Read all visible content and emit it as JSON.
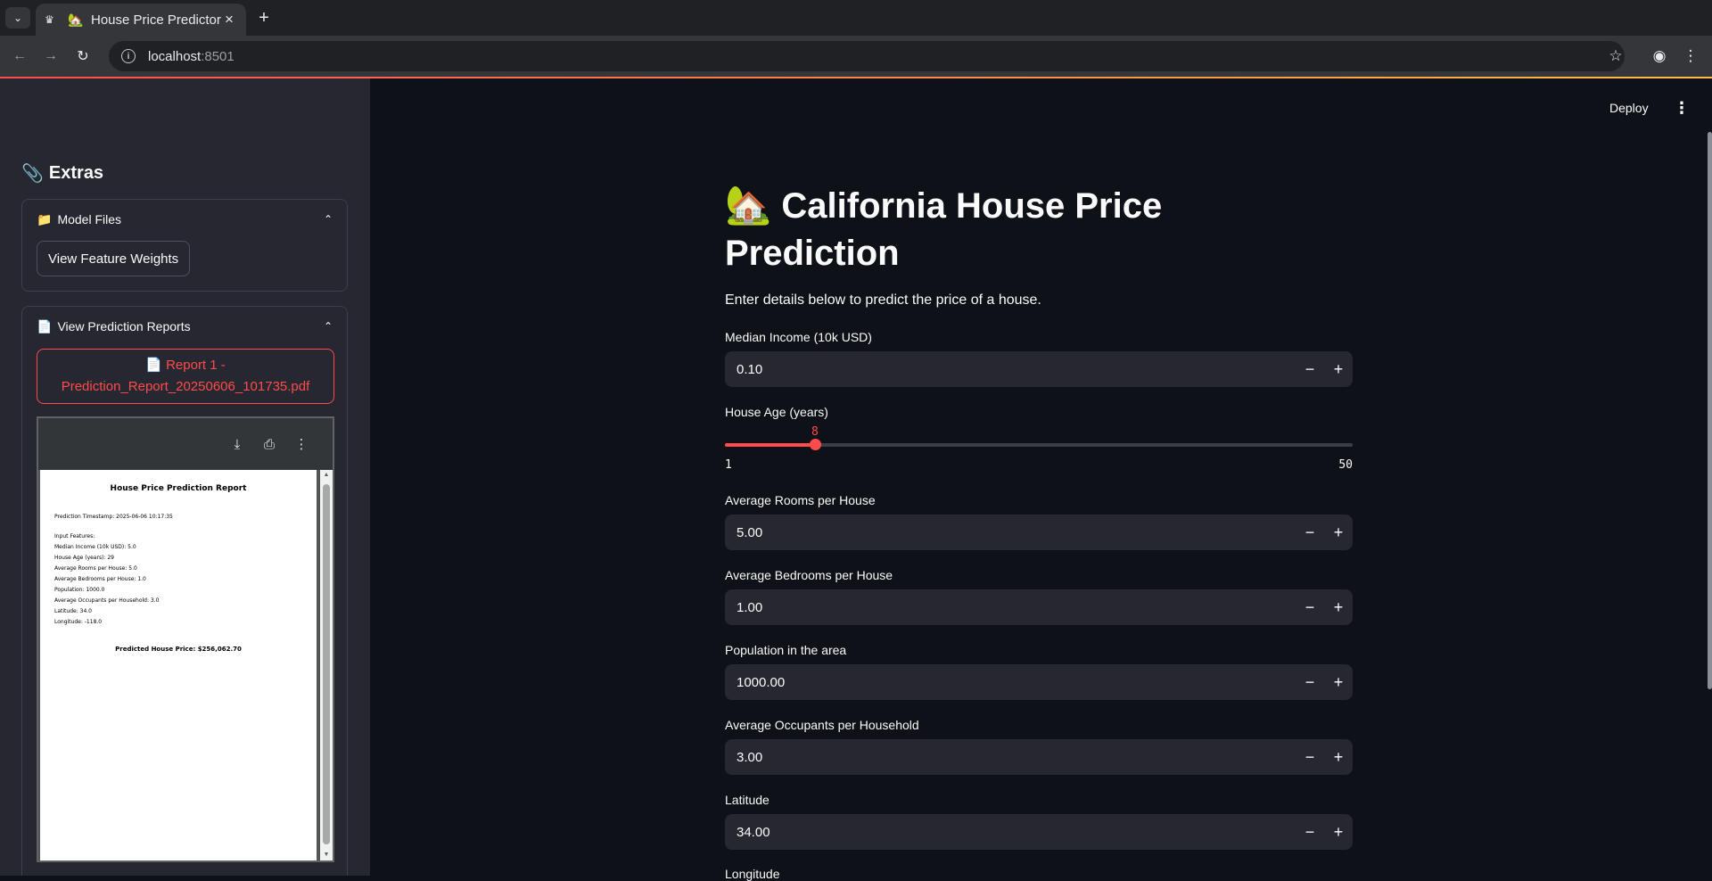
{
  "browser": {
    "tab_title": "House Price Predictor",
    "url_host": "localhost",
    "url_port": ":8501"
  },
  "sidebar": {
    "heading": "Extras",
    "model_files": {
      "label": "Model Files",
      "button": "View Feature Weights"
    },
    "reports": {
      "label": "View Prediction Reports",
      "report_button_line1": "Report 1 -",
      "report_button_line2": "Prediction_Report_20250606_101735.pdf",
      "pdf": {
        "title": "House Price Prediction Report",
        "timestamp": "Prediction Timestamp: 2025-06-06 10:17:35",
        "features_heading": "Input Features:",
        "features": [
          "Median Income (10k USD): 5.0",
          "House Age (years): 29",
          "Average Rooms per House: 5.0",
          "Average Bedrooms per House: 1.0",
          "Population: 1000.0",
          "Average Occupants per Household: 3.0",
          "Latitude: 34.0",
          "Longitude: -118.0"
        ],
        "predicted": "Predicted House Price: $256,062.70"
      }
    }
  },
  "main": {
    "deploy": "Deploy",
    "title_line1": "California House Price",
    "title_line2": "Prediction",
    "subtitle": "Enter details below to predict the price of a house.",
    "inputs": [
      {
        "label": "Median Income (10k USD)",
        "value": "0.10"
      },
      {
        "label": "Average Rooms per House",
        "value": "5.00"
      },
      {
        "label": "Average Bedrooms per House",
        "value": "1.00"
      },
      {
        "label": "Population in the area",
        "value": "1000.00"
      },
      {
        "label": "Average Occupants per Household",
        "value": "3.00"
      },
      {
        "label": "Latitude",
        "value": "34.00"
      }
    ],
    "next_label": "Longitude",
    "slider": {
      "label": "House Age (years)",
      "value": 8,
      "min": 1,
      "max": 50
    }
  },
  "colors": {
    "accent": "#ff4b4b",
    "background": "#0e1117",
    "sidebar": "#262730",
    "text": "#fafafa"
  }
}
